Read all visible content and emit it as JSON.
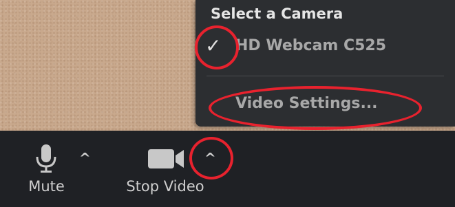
{
  "camera_menu": {
    "header": "Select a Camera",
    "cameras": [
      {
        "label": "HD Webcam C525",
        "selected": true
      }
    ],
    "settings_label": "Video Settings..."
  },
  "toolbar": {
    "mute_label": "Mute",
    "stop_video_label": "Stop Video"
  },
  "icons": {
    "mic": "microphone-icon",
    "camera": "video-camera-icon",
    "check": "checkmark-icon",
    "caret": "caret-up-icon"
  },
  "colors": {
    "toolbar_bg": "#1f2125",
    "menu_bg": "#2c2e31",
    "annotation": "#e8222e"
  }
}
